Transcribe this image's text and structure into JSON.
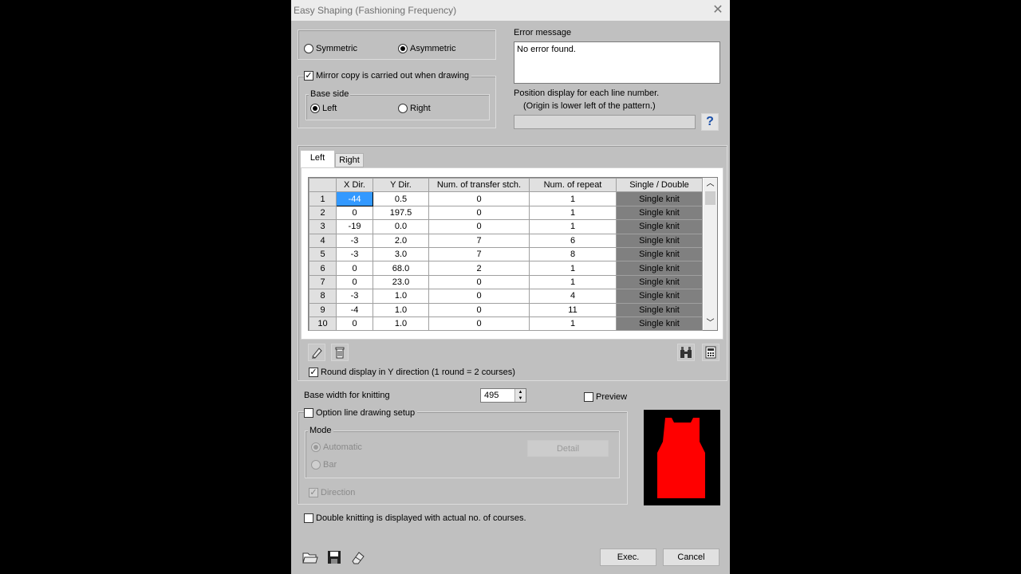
{
  "window": {
    "title": "Easy Shaping (Fashioning Frequency)",
    "close_glyph": "✕"
  },
  "symmetry": {
    "symmetric_label": "Symmetric",
    "asymmetric_label": "Asymmetric",
    "selected": "asymmetric"
  },
  "mirror": {
    "label": "Mirror copy is carried out when drawing",
    "checked": true
  },
  "base_side": {
    "title": "Base side",
    "left_label": "Left",
    "right_label": "Right",
    "selected": "left"
  },
  "error": {
    "title": "Error message",
    "text": "No error found."
  },
  "position": {
    "line1": "Position display for each line number.",
    "line2": "(Origin is lower left of the pattern.)",
    "value": "",
    "help_glyph": "?"
  },
  "tabs": [
    {
      "label": "Left",
      "active": true
    },
    {
      "label": "Right",
      "active": false
    }
  ],
  "table": {
    "columns": [
      "X Dir.",
      "Y Dir.",
      "Num. of transfer stch.",
      "Num. of repeat",
      "Single / Double"
    ],
    "rows": [
      [
        "1",
        "-44",
        "0.5",
        "0",
        "1",
        "Single knit"
      ],
      [
        "2",
        "0",
        "197.5",
        "0",
        "1",
        "Single knit"
      ],
      [
        "3",
        "-19",
        "0.0",
        "0",
        "1",
        "Single knit"
      ],
      [
        "4",
        "-3",
        "2.0",
        "7",
        "6",
        "Single knit"
      ],
      [
        "5",
        "-3",
        "3.0",
        "7",
        "8",
        "Single knit"
      ],
      [
        "6",
        "0",
        "68.0",
        "2",
        "1",
        "Single knit"
      ],
      [
        "7",
        "0",
        "23.0",
        "0",
        "1",
        "Single knit"
      ],
      [
        "8",
        "-3",
        "1.0",
        "0",
        "4",
        "Single knit"
      ],
      [
        "9",
        "-4",
        "1.0",
        "0",
        "11",
        "Single knit"
      ],
      [
        "10",
        "0",
        "1.0",
        "0",
        "1",
        "Single knit"
      ]
    ]
  },
  "round_display": {
    "label": "Round display in Y direction (1 round = 2 courses)",
    "checked": true
  },
  "base_width": {
    "label": "Base width for knitting",
    "value": "495"
  },
  "preview": {
    "label": "Preview",
    "checked": false,
    "shape_color": "#ff0000"
  },
  "option_line": {
    "label": "Option line drawing setup",
    "checked": false
  },
  "mode": {
    "title": "Mode",
    "automatic_label": "Automatic",
    "bar_label": "Bar",
    "selected": "automatic",
    "detail_label": "Detail"
  },
  "direction": {
    "label": "Direction",
    "checked": true
  },
  "double_knit": {
    "label": "Double knitting is displayed with actual no. of courses.",
    "checked": false
  },
  "buttons": {
    "exec_label": "Exec.",
    "cancel_label": "Cancel"
  },
  "colors": {
    "dialog_bg": "#c0c0c0",
    "selection": "#3399ff",
    "single_knit_cell": "#808080"
  }
}
